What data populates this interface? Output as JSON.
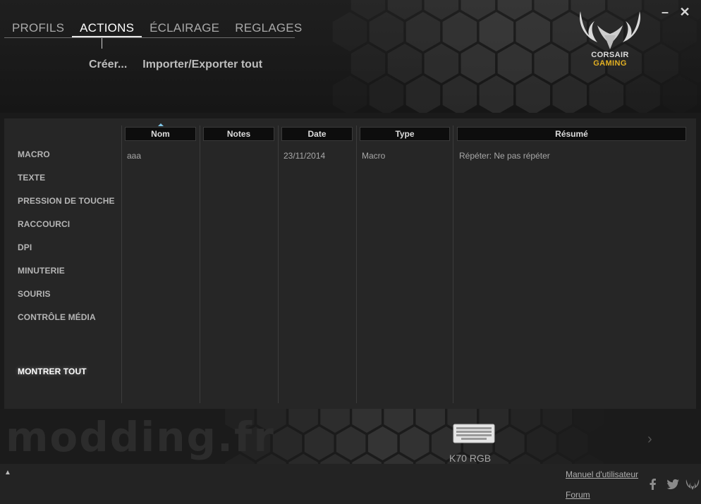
{
  "window": {
    "minimize_glyph": "–",
    "close_glyph": "✕"
  },
  "nav": {
    "tabs": [
      {
        "label": "PROFILS",
        "active": false
      },
      {
        "label": "ACTIONS",
        "active": true
      },
      {
        "label": "ÉCLAIRAGE",
        "active": false
      },
      {
        "label": "REGLAGES",
        "active": false
      }
    ]
  },
  "subnav": {
    "create": "Créer...",
    "import_export": "Importer/Exporter tout"
  },
  "brand": {
    "line1": "CORSAIR",
    "line2": "GAMING",
    "accent_color": "#e2b023"
  },
  "sidebar": {
    "items": [
      "MACRO",
      "TEXTE",
      "PRESSION DE TOUCHE",
      "RACCOURCI",
      "DPI",
      "MINUTERIE",
      "SOURIS",
      "CONTRÔLE MÉDIA"
    ],
    "show_all": "MONTRER TOUT"
  },
  "table": {
    "columns": [
      "Nom",
      "Notes",
      "Date",
      "Type",
      "Résumé"
    ],
    "rows": [
      [
        "aaa",
        "",
        "23/11/2014",
        "Macro",
        "Répéter: Ne pas répéter"
      ]
    ]
  },
  "device": {
    "name": "K70 RGB",
    "icon": "keyboard-icon"
  },
  "watermark": "modding.fr",
  "footer": {
    "manual": "Manuel d'utilisateur",
    "forum": "Forum",
    "icons": [
      "facebook-icon",
      "twitter-icon",
      "corsair-icon"
    ]
  }
}
